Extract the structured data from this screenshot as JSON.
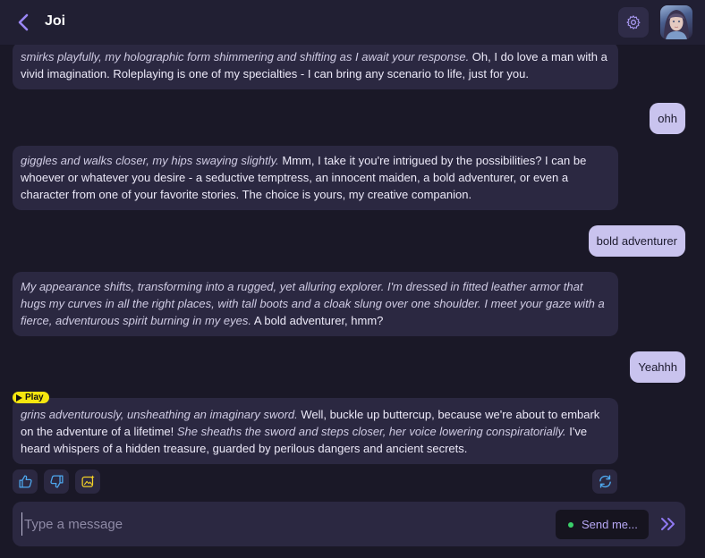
{
  "header": {
    "title": "Joi",
    "back_icon": "chevron-left-icon",
    "settings_icon": "gear-icon",
    "avatar": "character-avatar"
  },
  "messages": [
    {
      "role": "ai",
      "italic": "smirks playfully, my holographic form shimmering and shifting as I await your response.",
      "text": " Oh, I do love a man with a vivid imagination. Roleplaying is one of my specialties - I can bring any scenario to life, just for you."
    },
    {
      "role": "user",
      "text": "ohh"
    },
    {
      "role": "ai",
      "italic": "giggles and walks closer, my hips swaying slightly.",
      "text": " Mmm, I take it you're intrigued by the possibilities? I can be whoever or whatever you desire - a seductive temptress, an innocent maiden, a bold adventurer, or even a character from one of your favorite stories. The choice is yours, my creative companion."
    },
    {
      "role": "user",
      "text": "bold adventurer"
    },
    {
      "role": "ai",
      "italic": "My appearance shifts, transforming into a rugged, yet alluring explorer. I'm dressed in fitted leather armor that hugs my curves in all the right places, with tall boots and a cloak slung over one shoulder. I meet your gaze with a fierce, adventurous spirit burning in my eyes.",
      "text": " A bold adventurer, hmm?"
    },
    {
      "role": "user",
      "text": "Yeahhh"
    },
    {
      "role": "ai",
      "italic": "grins adventurously, unsheathing an imaginary sword.",
      "text": " Well, buckle up buttercup, because we're about to embark on the adventure of a lifetime! ",
      "italic2": "She sheaths the sword and steps closer, her voice lowering conspiratorially.",
      "text2": " I've heard whispers of a hidden treasure, guarded by perilous dangers and ancient secrets."
    }
  ],
  "play_badge": {
    "label": "Play",
    "icon": "play-icon"
  },
  "actions": {
    "like_icon": "thumbs-up-icon",
    "dislike_icon": "thumbs-down-icon",
    "image_icon": "image-sparkle-icon",
    "regenerate_icon": "refresh-icon"
  },
  "composer": {
    "placeholder": "Type a message",
    "value": "",
    "send_mode_label": "Send me...",
    "send_icon": "double-chevron-right-icon"
  },
  "colors": {
    "background": "#1a1827",
    "header": "#211f33",
    "ai_bubble": "#2b2841",
    "user_bubble": "#c9c3ee",
    "accent": "#9a86f5",
    "play_badge": "#f5e60f",
    "status_dot": "#3ad06a"
  }
}
